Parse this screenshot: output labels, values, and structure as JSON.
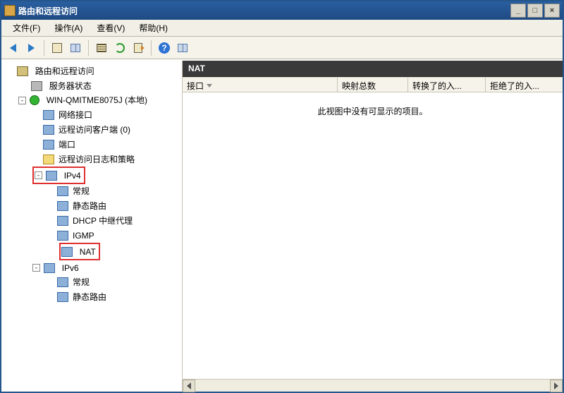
{
  "title": "路由和远程访问",
  "menus": {
    "file": "文件(F)",
    "action": "操作(A)",
    "view": "查看(V)",
    "help": "帮助(H)"
  },
  "toolbar_icons": {
    "back": "back-arrow-icon",
    "forward": "forward-arrow-icon",
    "up": "up-folder-icon",
    "showhide": "showhide-tree-icon",
    "properties": "properties-icon",
    "refresh": "refresh-icon",
    "export": "export-list-icon",
    "help": "help-icon",
    "columns": "columns-icon"
  },
  "tree": {
    "root": "路由和远程访问",
    "server_status": "服务器状态",
    "server_name": "WIN-QMITME8075J (本地)",
    "network_interfaces": "网络接口",
    "remote_access_clients": "远程访问客户端 (0)",
    "ports": "端口",
    "remote_access_logging": "远程访问日志和策略",
    "ipv4": {
      "label": "IPv4",
      "general": "常规",
      "static_routes": "静态路由",
      "dhcp_relay": "DHCP 中继代理",
      "igmp": "IGMP",
      "nat": "NAT"
    },
    "ipv6": {
      "label": "IPv6",
      "general": "常规",
      "static_routes": "静态路由"
    }
  },
  "detail": {
    "header": "NAT",
    "columns": {
      "interface": "接口",
      "total_mappings": "映射总数",
      "inbound_translated": "转换了的入...",
      "inbound_rejected": "拒绝了的入..."
    },
    "empty_message": "此视图中没有可显示的项目。"
  },
  "expanders": {
    "minus": "-",
    "plus": "+"
  },
  "help_glyph": "?"
}
